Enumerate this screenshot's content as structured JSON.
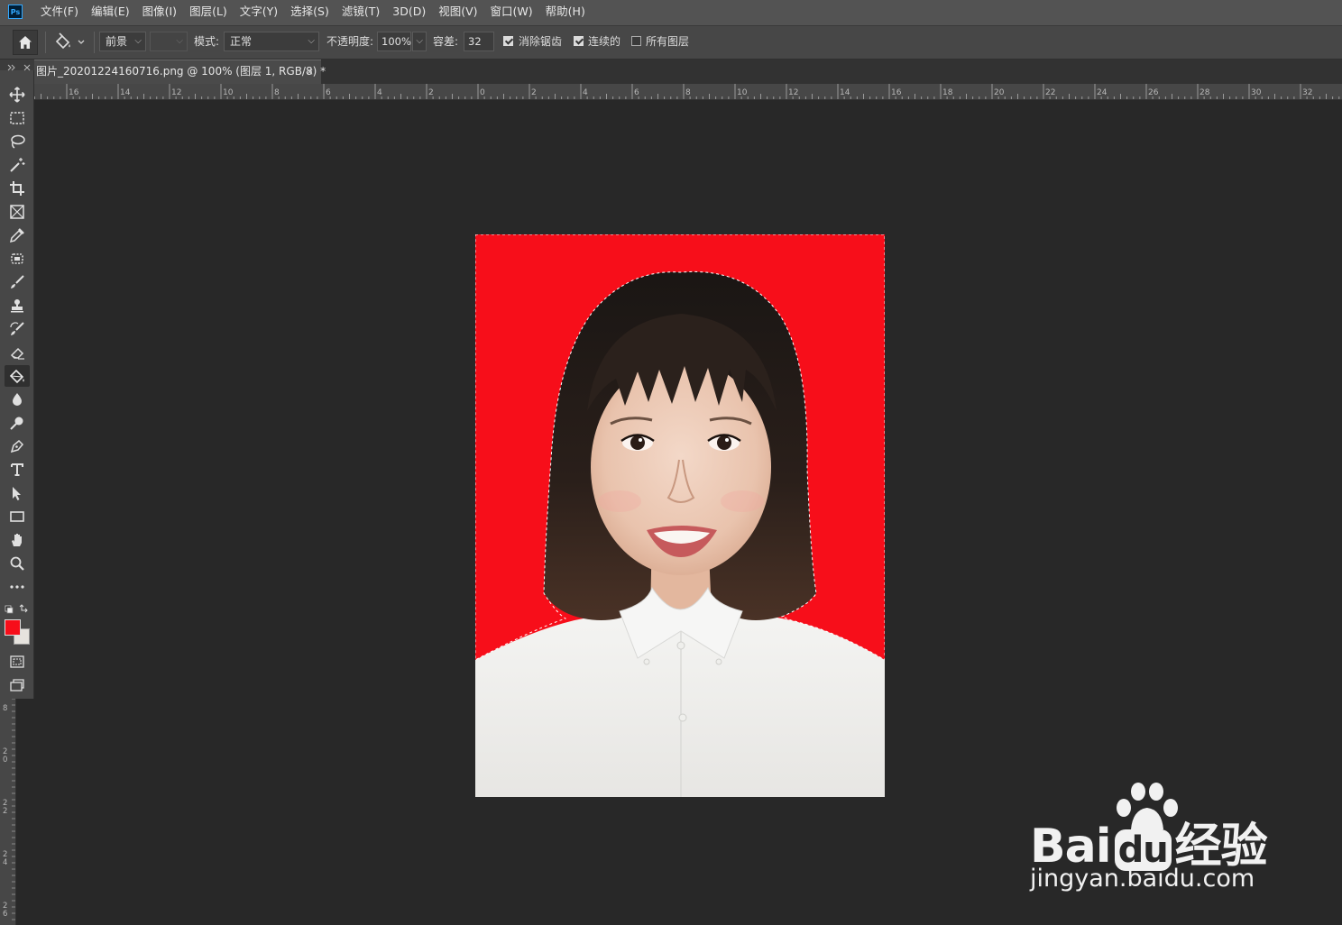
{
  "app": {
    "logo": "Ps"
  },
  "menu": [
    "文件(F)",
    "编辑(E)",
    "图像(I)",
    "图层(L)",
    "文字(Y)",
    "选择(S)",
    "滤镜(T)",
    "3D(D)",
    "视图(V)",
    "窗口(W)",
    "帮助(H)"
  ],
  "options": {
    "fill_source": "前景",
    "mode_label": "模式:",
    "mode_value": "正常",
    "opacity_label": "不透明度:",
    "opacity_value": "100%",
    "tolerance_label": "容差:",
    "tolerance_value": "32",
    "antialias_label": "消除锯齿",
    "antialias_checked": true,
    "contiguous_label": "连续的",
    "contiguous_checked": true,
    "all_layers_label": "所有图层",
    "all_layers_checked": false
  },
  "document": {
    "tab_title": "图片_20201224160716.png @ 100% (图层 1, RGB/8) *",
    "close_glyph": "×"
  },
  "ruler": {
    "top_labels": [
      "16",
      "14",
      "12",
      "10",
      "8",
      "6",
      "4",
      "2",
      "0",
      "2",
      "4",
      "6",
      "8",
      "10",
      "12",
      "14",
      "16",
      "18",
      "20",
      "22",
      "24",
      "26",
      "28",
      "30",
      "32"
    ],
    "left_labels": [
      "8",
      "20",
      "22",
      "24",
      "26"
    ]
  },
  "colors": {
    "foreground": "#f70e1a",
    "background": "#e6e3de",
    "photo_background": "#f70e1a"
  },
  "tools": [
    "move-icon",
    "marquee-icon",
    "lasso-icon",
    "magic-wand-icon",
    "crop-icon",
    "frame-icon",
    "eyedropper-icon",
    "healing-brush-icon",
    "brush-icon",
    "stamp-icon",
    "history-brush-icon",
    "eraser-icon",
    "paint-bucket-icon",
    "blur-icon",
    "dodge-icon",
    "pen-icon",
    "type-icon",
    "path-select-icon",
    "rectangle-icon",
    "hand-icon",
    "zoom-icon",
    "more-tools-icon"
  ],
  "watermark": {
    "brand": "Bai",
    "brand2": "du",
    "brand3": "经验",
    "url": "jingyan.baidu.com"
  }
}
